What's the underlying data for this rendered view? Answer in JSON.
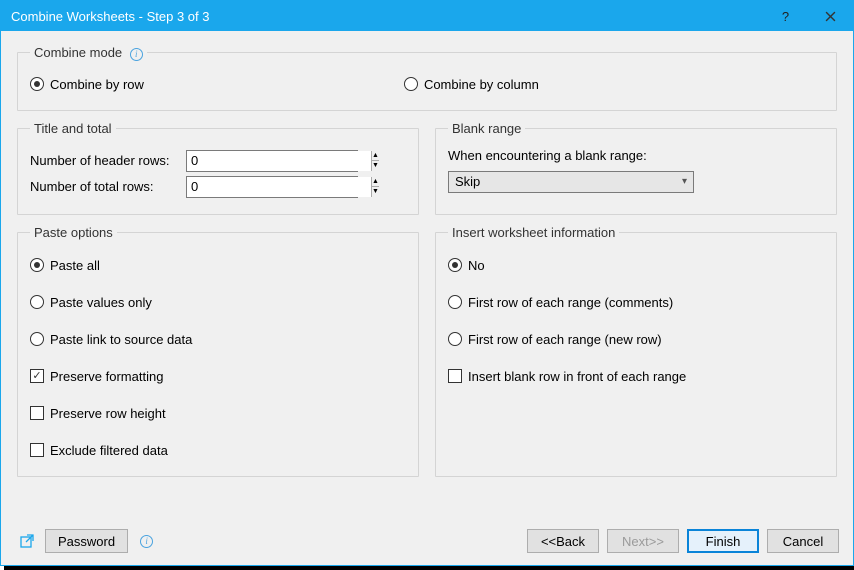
{
  "titlebar": {
    "title": "Combine Worksheets - Step 3 of 3"
  },
  "combine_mode": {
    "legend": "Combine mode",
    "by_row": "Combine by row",
    "by_column": "Combine by column",
    "selected": "by_row"
  },
  "title_total": {
    "legend": "Title and total",
    "header_label": "Number of header rows:",
    "header_value": "0",
    "total_label": "Number of total rows:",
    "total_value": "0"
  },
  "blank_range": {
    "legend": "Blank range",
    "label": "When encountering a blank range:",
    "selected": "Skip"
  },
  "paste_options": {
    "legend": "Paste options",
    "paste_all": "Paste all",
    "paste_values": "Paste values only",
    "paste_link": "Paste link to source data",
    "preserve_formatting": "Preserve formatting",
    "preserve_row_height": "Preserve row height",
    "exclude_filtered": "Exclude filtered data",
    "radio_selected": "paste_all",
    "preserve_formatting_checked": true,
    "preserve_row_height_checked": false,
    "exclude_filtered_checked": false
  },
  "insert_info": {
    "legend": "Insert worksheet information",
    "no": "No",
    "first_comments": "First row of each range (comments)",
    "first_newrow": "First row of each range (new row)",
    "insert_blank": "Insert blank row in front of each range",
    "radio_selected": "no",
    "insert_blank_checked": false
  },
  "footer": {
    "password": "Password",
    "back": "<<Back",
    "next": "Next>>",
    "finish": "Finish",
    "cancel": "Cancel"
  }
}
